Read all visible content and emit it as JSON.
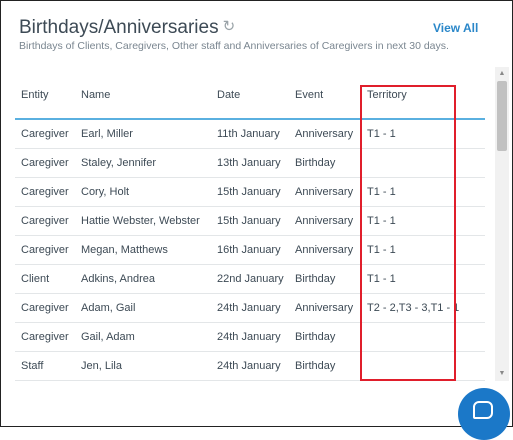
{
  "header": {
    "title": "Birthdays/Anniversaries",
    "subtitle": "Birthdays of Clients, Caregivers, Other staff and Anniversaries of Caregivers in next 30 days.",
    "view_all": "View All",
    "refresh_icon": "refresh-icon"
  },
  "table": {
    "columns": [
      "Entity",
      "Name",
      "Date",
      "Event",
      "Territory"
    ],
    "rows": [
      [
        "Caregiver",
        "Earl, Miller",
        "11th January",
        "Anniversary",
        "T1 - 1"
      ],
      [
        "Caregiver",
        "Staley, Jennifer",
        "13th January",
        "Birthday",
        ""
      ],
      [
        "Caregiver",
        "Cory, Holt",
        "15th January",
        "Anniversary",
        "T1 - 1"
      ],
      [
        "Caregiver",
        "Hattie Webster, Webster",
        "15th January",
        "Anniversary",
        "T1 - 1"
      ],
      [
        "Caregiver",
        "Megan, Matthews",
        "16th January",
        "Anniversary",
        "T1 - 1"
      ],
      [
        "Client",
        "Adkins, Andrea",
        "22nd January",
        "Birthday",
        "T1 - 1"
      ],
      [
        "Caregiver",
        "Adam, Gail",
        "24th January",
        "Anniversary",
        "T2 - 2,T3 - 3,T1 - 1"
      ],
      [
        "Caregiver",
        "Gail, Adam",
        "24th January",
        "Birthday",
        ""
      ],
      [
        "Staff",
        "Jen, Lila",
        "24th January",
        "Birthday",
        ""
      ]
    ]
  },
  "colors": {
    "accent": "#2a87c9",
    "header_underline": "#5ab0e0",
    "highlight": "#e01e2b",
    "chat_button": "#1b78c8"
  },
  "chat": {
    "icon": "chat-icon"
  }
}
